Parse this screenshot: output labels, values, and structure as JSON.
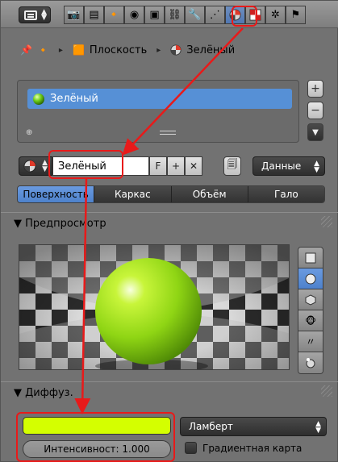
{
  "breadcrumb": {
    "object": "Плоскость",
    "material": "Зелёный"
  },
  "slots": [
    {
      "label": "Зелёный",
      "color": "#8ee02a"
    }
  ],
  "material": {
    "name": "Зелёный",
    "fake_user_label": "F",
    "link_dropdown": "Данные"
  },
  "type_tabs": [
    "Поверхность",
    "Каркас",
    "Объём",
    "Гало"
  ],
  "sections": {
    "preview": "▼ Предпросмотр",
    "diffuse": "▼ Диффуз."
  },
  "diffuse": {
    "color": "#d4ff00",
    "intensity": "Интенсивност: 1.000",
    "shader": "Ламберт",
    "ramp_label": "Градиентная карта"
  },
  "annotation_color": "#e81a1a"
}
